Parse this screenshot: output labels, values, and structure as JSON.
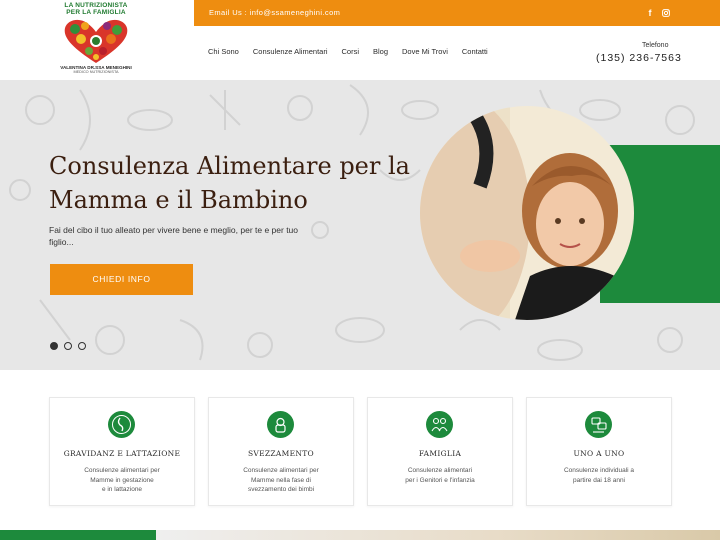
{
  "header": {
    "logo": {
      "line1": "LA NUTRIZIONISTA",
      "line2": "PER LA FAMIGLIA",
      "name": "VALENTINA DR.SSA MENEGHINI",
      "role": "MEDICO NUTRIZIONISTA"
    },
    "email": "Email Us : info@ssameneghini.com",
    "social": [
      "facebook-icon",
      "instagram-icon"
    ],
    "nav": [
      "Chi Sono",
      "Consulenze Alimentari",
      "Corsi",
      "Blog",
      "Dove Mi Trovi",
      "Contatti"
    ],
    "phone_label": "Telefono",
    "phone": "(135) 236-7563"
  },
  "hero": {
    "title": "Consulenza Alimentare per la Mamma e il Bambino",
    "text": "Fai del cibo il tuo alleato per vivere bene e meglio, per te e per tuo figlio...",
    "cta": "CHIEDI INFO",
    "slides": 3,
    "active_slide": 1
  },
  "features": [
    {
      "title": "GRAVIDANZ  E LATTAZIONE",
      "text": "Consulenze alimentari per\nMamme in gestazione\ne in lattazione",
      "icon": "pregnancy-icon"
    },
    {
      "title": "SVEZZAMENTO",
      "text": "Consulenze alimentari per\nMamme nella fase di\nsvezzamento dei bimbi",
      "icon": "baby-bottle-icon"
    },
    {
      "title": "FAMIGLIA",
      "text": "Consulenze alimentari\nper i Genitori e l'infanzia",
      "icon": "family-icon"
    },
    {
      "title": "UNO A UNO",
      "text": "Consulenze individuali a\npartire dai 18 anni",
      "icon": "consultation-icon"
    }
  ],
  "colors": {
    "accent": "#ee8d10",
    "green": "#1d8a3c",
    "title": "#3b1f10"
  }
}
